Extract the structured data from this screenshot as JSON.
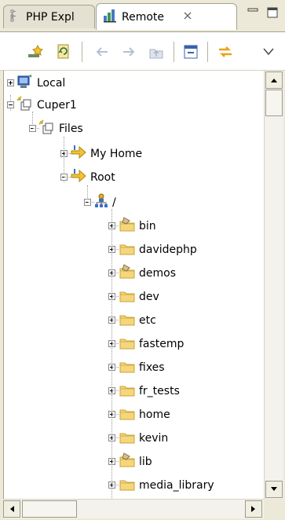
{
  "tabs": [
    {
      "label": "PHP Expl",
      "icon": "php-explorer-icon"
    },
    {
      "label": "Remote",
      "icon": "remote-systems-icon"
    }
  ],
  "toolbar": {
    "buttons": [
      {
        "icon": "new-connection-icon"
      },
      {
        "icon": "refresh-icon"
      },
      {
        "icon": "back-arrow-icon"
      },
      {
        "icon": "forward-arrow-icon"
      },
      {
        "icon": "up-folder-icon"
      },
      {
        "icon": "collapse-all-icon"
      },
      {
        "icon": "link-with-editor-icon"
      },
      {
        "icon": "view-menu-icon"
      }
    ]
  },
  "tree": {
    "local": "Local",
    "connection": "Cuper1",
    "files": "Files",
    "my_home": "My Home",
    "root": "Root",
    "root_dir": "/",
    "folders": [
      {
        "label": "bin",
        "shared": true
      },
      {
        "label": "davidephp",
        "shared": false
      },
      {
        "label": "demos",
        "shared": true
      },
      {
        "label": "dev",
        "shared": false
      },
      {
        "label": "etc",
        "shared": false
      },
      {
        "label": "fastemp",
        "shared": false
      },
      {
        "label": "fixes",
        "shared": false
      },
      {
        "label": "fr_tests",
        "shared": false
      },
      {
        "label": "home",
        "shared": false
      },
      {
        "label": "kevin",
        "shared": false
      },
      {
        "label": "lib",
        "shared": true
      },
      {
        "label": "media_library",
        "shared": false
      }
    ]
  },
  "colors": {
    "folder": "#f5d67a",
    "folder_edge": "#c9a33b",
    "arrow": "#e8a317",
    "accent": "#4a78c2"
  }
}
